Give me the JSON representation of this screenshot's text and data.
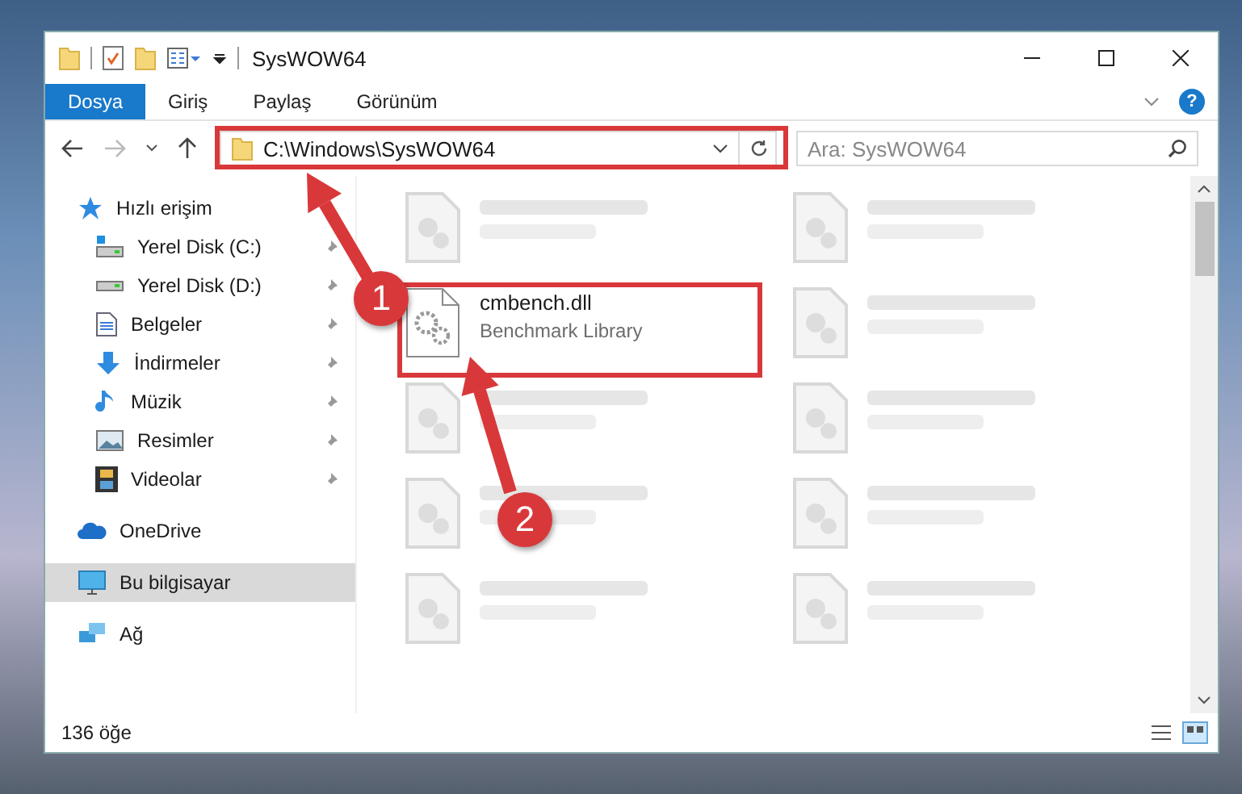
{
  "window": {
    "title": "SysWOW64"
  },
  "ribbon": {
    "tabs": [
      {
        "label": "Dosya",
        "selected": true
      },
      {
        "label": "Giriş",
        "selected": false
      },
      {
        "label": "Paylaş",
        "selected": false
      },
      {
        "label": "Görünüm",
        "selected": false
      }
    ],
    "help": "?"
  },
  "address_bar": {
    "path": "C:\\Windows\\SysWOW64"
  },
  "search": {
    "placeholder": "Ara: SysWOW64"
  },
  "sidebar": {
    "items": [
      {
        "label": "Hızlı erişim",
        "kind": "star",
        "selected": false,
        "children": [
          {
            "label": "Yerel Disk (C:)",
            "kind": "system-drive",
            "pinned": true,
            "selected": false
          },
          {
            "label": "Yerel Disk (D:)",
            "kind": "drive",
            "pinned": true,
            "selected": false
          },
          {
            "label": "Belgeler",
            "kind": "documents",
            "pinned": true,
            "selected": false
          },
          {
            "label": "İndirmeler",
            "kind": "downloads",
            "pinned": true,
            "selected": false
          },
          {
            "label": "Müzik",
            "kind": "music",
            "pinned": true,
            "selected": false
          },
          {
            "label": "Resimler",
            "kind": "pictures",
            "pinned": true,
            "selected": false
          },
          {
            "label": "Videolar",
            "kind": "videos",
            "pinned": true,
            "selected": false
          }
        ]
      },
      {
        "label": "OneDrive",
        "kind": "cloud",
        "selected": false
      },
      {
        "label": "Bu bilgisayar",
        "kind": "computer",
        "selected": true
      },
      {
        "label": "Ağ",
        "kind": "network",
        "selected": false
      }
    ]
  },
  "files": [
    {
      "blurred": true
    },
    {
      "blurred": true
    },
    {
      "name": "cmbench.dll",
      "type": "Benchmark Library",
      "blurred": false
    },
    {
      "blurred": true
    },
    {
      "blurred": true
    },
    {
      "blurred": true
    },
    {
      "blurred": true
    },
    {
      "blurred": true
    },
    {
      "blurred": true
    },
    {
      "blurred": true
    }
  ],
  "status_bar": {
    "count": "136 öğe"
  },
  "annotations": [
    {
      "number": "1"
    },
    {
      "number": "2"
    }
  ]
}
